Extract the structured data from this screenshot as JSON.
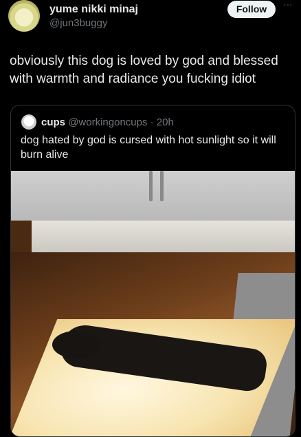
{
  "author": {
    "display_name": "yume nikki minaj",
    "handle": "@jun3buggy"
  },
  "follow_button": {
    "label": "Follow"
  },
  "more_button": {
    "label": "···"
  },
  "tweet": {
    "text": "obviously this dog is loved by god and blessed with warmth and radiance you fucking idiot"
  },
  "quoted_tweet": {
    "display_name": "cups",
    "meta": "@workingoncups · 20h",
    "text": "dog hated by god is cursed with hot sunlight so it will burn alive"
  },
  "colors": {
    "background": "#000000",
    "text_primary": "#e7e9ea",
    "text_secondary": "#71767b",
    "border": "#2f3336",
    "button_bg": "#eff3f4"
  }
}
